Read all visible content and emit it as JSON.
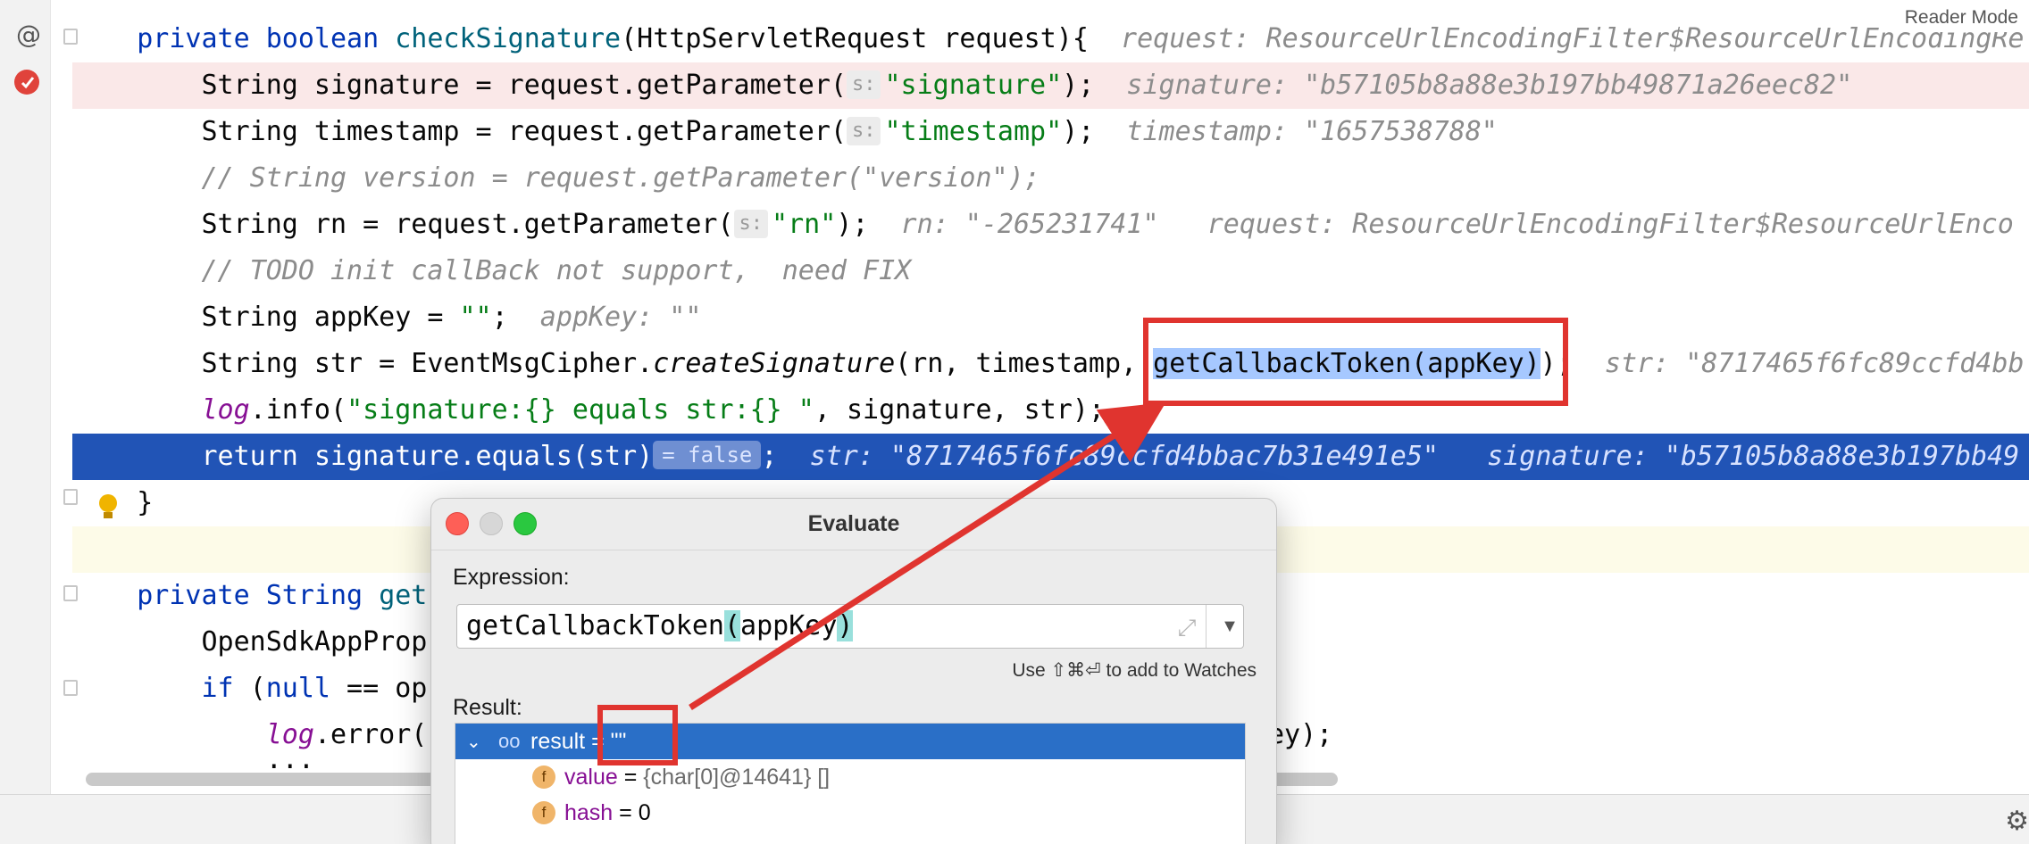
{
  "editor": {
    "lines": [
      {
        "kw": "private boolean ",
        "fn": "checkSignature",
        "rest": "(HttpServletRequest request){",
        "hint": "request: ResourceUrlEncodingFilter$ResourceUrlEncodingRe"
      },
      {
        "code_a": "String signature = request.getParameter(",
        "param": "s:",
        "str": "\"signature\"",
        "code_b": ");",
        "hint": "signature: \"b57105b8a88e3b197bb49871a26eec82\""
      },
      {
        "code_a": "String timestamp = request.getParameter(",
        "param": "s:",
        "str": "\"timestamp\"",
        "code_b": ");",
        "hint": "timestamp: \"1657538788\""
      },
      {
        "comment": "// String version = request.getParameter(\"version\");"
      },
      {
        "code_a": "String rn = request.getParameter(",
        "param": "s:",
        "str": "\"rn\"",
        "code_b": ");",
        "hint": "rn: \"-265231741\"",
        "hint2": "request: ResourceUrlEncodingFilter$ResourceUrlEnco"
      },
      {
        "comment": "// TODO init callBack not support,  need FIX"
      },
      {
        "code_a": "String appKey = ",
        "str": "\"\"",
        "code_b": ";",
        "hint": "appKey: \"\""
      },
      {
        "code_a": "String str = EventMsgCipher.",
        "italic": "createSignature",
        "code_b": "(rn, timestamp, ",
        "sel": "getCallbackToken(appKey)",
        "code_c": ");",
        "hint": "str: \"8717465f6fc89ccfd4bb"
      },
      {
        "log": "log",
        "code_a": ".info(",
        "str": "\"signature:{} equals str:{} \"",
        "code_b": ", signature, str);"
      },
      {
        "kw": "return ",
        "code_a": "signature.equals(str)",
        "badge": "= false",
        "code_b": ";",
        "hint": "str: \"8717465f6fc89ccfd4bbac7b31e491e5\"",
        "hint2": "signature: \"b57105b8a88e3b197bb49"
      },
      {
        "code_a": "}"
      },
      {
        "code_a": ""
      },
      {
        "kw": "private ",
        "code_a": "String ",
        "fn": "get"
      },
      {
        "code_a": "OpenSdkAppProp"
      },
      {
        "kw": "if ",
        "code_a": "(",
        "kw2": "null",
        "code_b": " == op"
      },
      {
        "log": "log",
        "code_a": ".error(",
        "tail": "ey);"
      },
      {
        "code_a": "..."
      }
    ]
  },
  "reader_mode": "Reader Mode",
  "evaluate": {
    "title": "Evaluate",
    "expression_label": "Expression:",
    "expression_parts": {
      "a": "getCallbackToken",
      "open": "(",
      "mid": "appKey",
      "close": ")"
    },
    "watch_hint": "Use ⇧⌘⏎ to add to Watches",
    "result_label": "Result:",
    "result": {
      "name": "result",
      "eq": " = ",
      "value": "\"\""
    },
    "fields": [
      {
        "badge": "f",
        "name": "value",
        "eq": " = ",
        "value": "{char[0]@14641} []"
      },
      {
        "badge": "f",
        "name": "hash",
        "eq": " = ",
        "value": "0"
      }
    ]
  },
  "colors": {
    "accent": "#2154b6",
    "annotation_red": "#e0342f",
    "selection": "#2a6fc7"
  }
}
